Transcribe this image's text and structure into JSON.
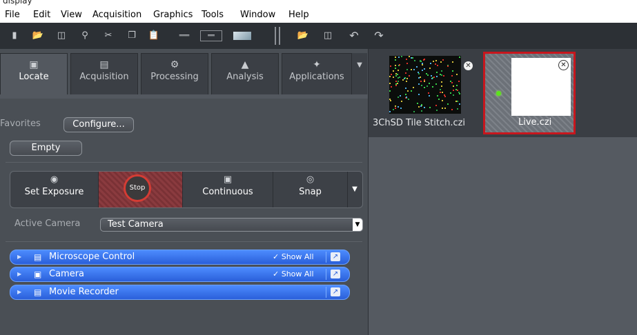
{
  "window": {
    "title_fragment": "display"
  },
  "menu": [
    "File",
    "Edit",
    "View",
    "Acquisition",
    "Graphics",
    "Tools",
    "Window",
    "Help"
  ],
  "toolbar": {
    "icons": [
      "new-icon",
      "open-folder-icon",
      "save-icon",
      "find-icon",
      "cut-icon",
      "copy-icon",
      "paste-icon",
      "ruler-icon",
      "frame-icon",
      "image-icon",
      "open-folder-icon",
      "save-icon",
      "undo-icon",
      "redo-icon"
    ]
  },
  "tabs": [
    {
      "label": "Locate",
      "active": true,
      "icon": "locate-icon"
    },
    {
      "label": "Acquisition",
      "active": false,
      "icon": "acquisition-icon"
    },
    {
      "label": "Processing",
      "active": false,
      "icon": "processing-icon"
    },
    {
      "label": "Analysis",
      "active": false,
      "icon": "analysis-icon"
    },
    {
      "label": "Applications",
      "active": false,
      "icon": "applications-icon"
    }
  ],
  "favorites": {
    "label": "Favorites",
    "configure_button": "Configure...",
    "empty_button": "Empty"
  },
  "camera_controls": {
    "set_exposure": "Set Exposure",
    "stop": "Stop",
    "continuous": "Continuous",
    "snap": "Snap"
  },
  "active_camera": {
    "label": "Active Camera",
    "value": "Test Camera"
  },
  "tool_panels": [
    {
      "title": "Microscope Control",
      "show_all": "✓ Show All",
      "icon": "panel-icon"
    },
    {
      "title": "Camera",
      "show_all": "✓ Show All",
      "icon": "camera-panel-icon"
    },
    {
      "title": "Movie Recorder",
      "show_all": "",
      "icon": "panel-icon"
    }
  ],
  "documents": [
    {
      "name": "3ChSD Tile Stitch.czi",
      "selected": false
    },
    {
      "name": "Live.czi",
      "selected": true
    }
  ],
  "colors": {
    "accent_blue": "#2a5fd9",
    "highlight_red": "#c8161d",
    "stop_ring": "#d43c34",
    "live_indicator": "#5be31a"
  }
}
